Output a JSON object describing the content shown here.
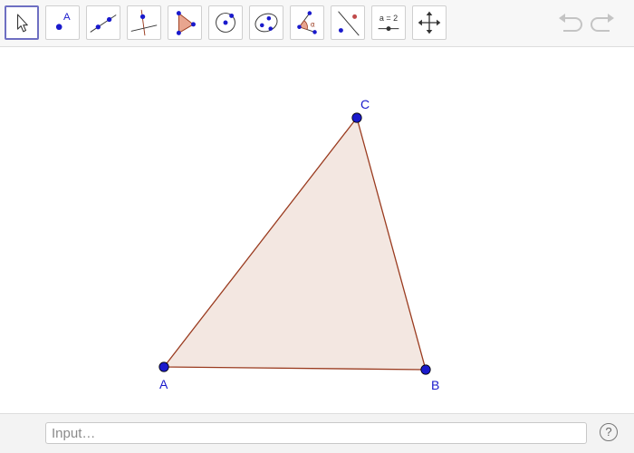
{
  "toolbar": {
    "tools": [
      {
        "icon": "move-icon",
        "active": true
      },
      {
        "icon": "point-icon",
        "label": "A"
      },
      {
        "icon": "line-icon"
      },
      {
        "icon": "perpendicular-line-icon"
      },
      {
        "icon": "polygon-icon"
      },
      {
        "icon": "circle-with-center-icon"
      },
      {
        "icon": "conic-through-points-icon"
      },
      {
        "icon": "angle-icon"
      },
      {
        "icon": "reflect-about-line-icon"
      },
      {
        "icon": "slider-icon",
        "label": "a = 2"
      },
      {
        "icon": "move-graphics-view-icon"
      }
    ],
    "undo_icon": "undo-icon",
    "redo_icon": "redo-icon"
  },
  "construction": {
    "points": [
      {
        "name": "A"
      },
      {
        "name": "B"
      },
      {
        "name": "C"
      }
    ],
    "polygon_fill": "#f3e7e1",
    "polygon_stroke": "#9a3b1f",
    "point_color": "#1a1acc"
  },
  "input_bar": {
    "placeholder": "Input…",
    "help_label": "?"
  }
}
